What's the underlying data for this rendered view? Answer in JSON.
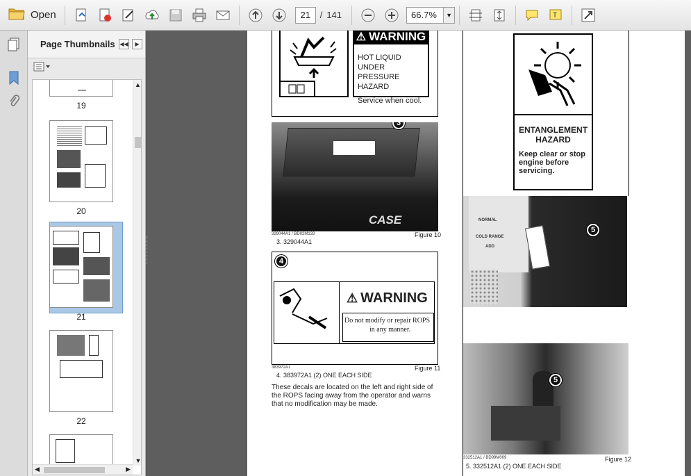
{
  "toolbar": {
    "open_label": "Open",
    "current_page": "21",
    "page_separator": "/",
    "total_pages": "141",
    "zoom": "66.7%"
  },
  "panel": {
    "title": "Page Thumbnails",
    "thumbnails": [
      {
        "label": "19"
      },
      {
        "label": "20"
      },
      {
        "label": "21",
        "selected": true
      },
      {
        "label": "22"
      },
      {
        "label": ""
      }
    ]
  },
  "document": {
    "left_column": {
      "warning_decal": {
        "header": "WARNING",
        "lines": [
          "HOT LIQUID UNDER",
          "PRESSURE HAZARD"
        ],
        "footer": "Service when cool."
      },
      "figure10": {
        "callout": "3",
        "brand": "CASE",
        "code": "329044A1 / BD02M133",
        "figure": "Figure 10",
        "item": "3.  329044A1"
      },
      "figure11": {
        "callout": "4",
        "header": "WARNING",
        "line1": "Do not modify or repair ROPS",
        "line2": "in any manner.",
        "code": "383972A1",
        "figure": "Figure 11",
        "item": "4.  383972A1 (2) ONE EACH SIDE",
        "paragraph": "These decals are located on the left and right side of the ROPS facing away from the operator and warns that no modification may be made."
      }
    },
    "right_column": {
      "entanglement": {
        "title_line1": "ENTANGLEMENT",
        "title_line2": "HAZARD",
        "body": "Keep clear or stop engine before servicing."
      },
      "photo1": {
        "callout": "5",
        "normal": "NORMAL",
        "cold_range": "COLD RANGE",
        "add": "ADD"
      },
      "figure12": {
        "callout": "5",
        "code": "332512A1 / BD99M009",
        "figure": "Figure 12",
        "item": "5.  332512A1 (2) ONE EACH SIDE"
      }
    }
  }
}
